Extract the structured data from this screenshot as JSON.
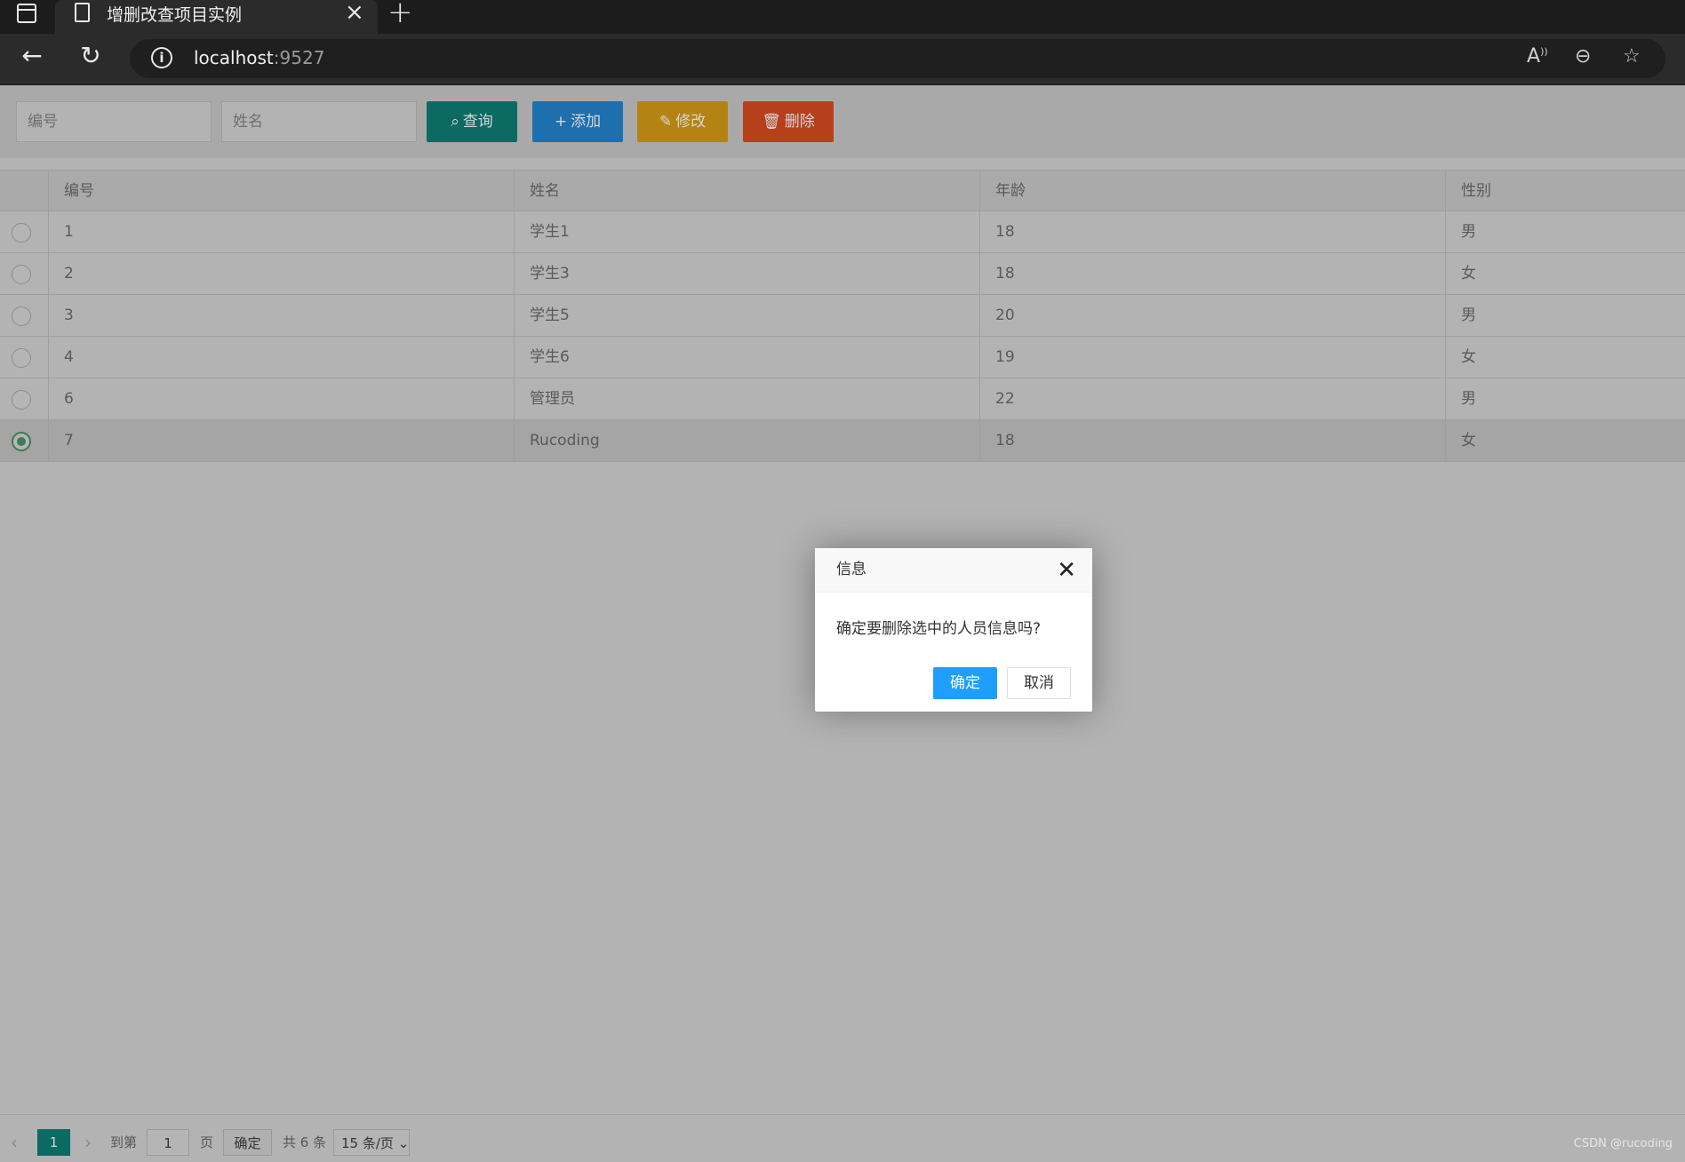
{
  "browser": {
    "tab_title": "增删改查项目实例",
    "url_host": "localhost",
    "url_port": ":9527"
  },
  "search": {
    "id_placeholder": "编号",
    "name_placeholder": "姓名",
    "query_label": "查询",
    "add_label": "添加",
    "edit_label": "修改",
    "delete_label": "删除"
  },
  "table": {
    "headers": [
      "编号",
      "姓名",
      "年龄",
      "性别"
    ],
    "rows": [
      {
        "id": "1",
        "name": "学生1",
        "age": "18",
        "gender": "男",
        "selected": false
      },
      {
        "id": "2",
        "name": "学生3",
        "age": "18",
        "gender": "女",
        "selected": false
      },
      {
        "id": "3",
        "name": "学生5",
        "age": "20",
        "gender": "男",
        "selected": false
      },
      {
        "id": "4",
        "name": "学生6",
        "age": "19",
        "gender": "女",
        "selected": false
      },
      {
        "id": "6",
        "name": "管理员",
        "age": "22",
        "gender": "男",
        "selected": false
      },
      {
        "id": "7",
        "name": "Rucoding",
        "age": "18",
        "gender": "女",
        "selected": true
      }
    ]
  },
  "pager": {
    "current_page": "1",
    "goto_label": "到第",
    "goto_value": "1",
    "page_unit": "页",
    "confirm_label": "确定",
    "total_text": "共 6 条",
    "page_size": "15 条/页"
  },
  "dialog": {
    "title": "信息",
    "message": "确定要删除选中的人员信息吗?",
    "ok_label": "确定",
    "cancel_label": "取消"
  },
  "watermark": "CSDN @rucoding"
}
